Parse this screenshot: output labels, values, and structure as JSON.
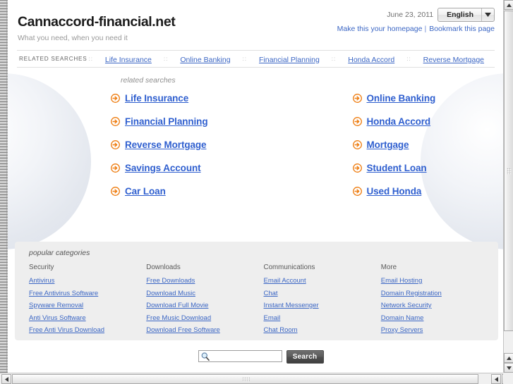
{
  "header": {
    "site_title": "Cannaccord-financial.net",
    "tagline": "What you need, when you need it",
    "date": "June 23, 2011",
    "language_selected": "English",
    "language_options": [
      "English"
    ],
    "homepage_link": "Make this your homepage",
    "bookmark_link": "Bookmark this page",
    "link_separator": "|"
  },
  "related_bar": {
    "label": "RELATED SEARCHES",
    "separator": "::",
    "items": [
      {
        "label": "Life Insurance"
      },
      {
        "label": "Online Banking"
      },
      {
        "label": "Financial Planning"
      },
      {
        "label": "Honda Accord"
      },
      {
        "label": "Reverse Mortgage"
      }
    ]
  },
  "main": {
    "heading": "related searches",
    "bullet_icon": "orange-arrow-circle-icon",
    "links_left": [
      {
        "label": "Life Insurance"
      },
      {
        "label": "Financial Planning"
      },
      {
        "label": "Reverse Mortgage"
      },
      {
        "label": "Savings Account"
      },
      {
        "label": "Car Loan"
      }
    ],
    "links_right": [
      {
        "label": "Online Banking"
      },
      {
        "label": "Honda Accord"
      },
      {
        "label": "Mortgage"
      },
      {
        "label": "Student Loan"
      },
      {
        "label": "Used Honda"
      }
    ]
  },
  "categories": {
    "heading": "popular categories",
    "columns": [
      {
        "title": "Security",
        "links": [
          "Antivirus",
          "Free Antivirus Software",
          "Spyware Removal",
          "Anti Virus Software",
          "Free Anti Virus Download"
        ]
      },
      {
        "title": "Downloads",
        "links": [
          "Free Downloads",
          "Download Music",
          "Download Full Movie",
          "Free Music Download",
          "Download Free Software"
        ]
      },
      {
        "title": "Communications",
        "links": [
          "Email Account",
          "Chat",
          "Instant Messenger",
          "Email",
          "Chat Room"
        ]
      },
      {
        "title": "More",
        "links": [
          "Email Hosting",
          "Domain Registration",
          "Network Security",
          "Domain Name",
          "Proxy Servers"
        ]
      }
    ]
  },
  "search": {
    "value": "",
    "placeholder": "",
    "button_label": "Search",
    "icon": "magnifier-icon"
  },
  "colors": {
    "link_blue": "#3b66c4",
    "big_link_blue": "#2f5fcf",
    "bullet_orange": "#ee7d11",
    "panel_gray": "#eeeeee",
    "muted_text": "#8f8f8f"
  }
}
